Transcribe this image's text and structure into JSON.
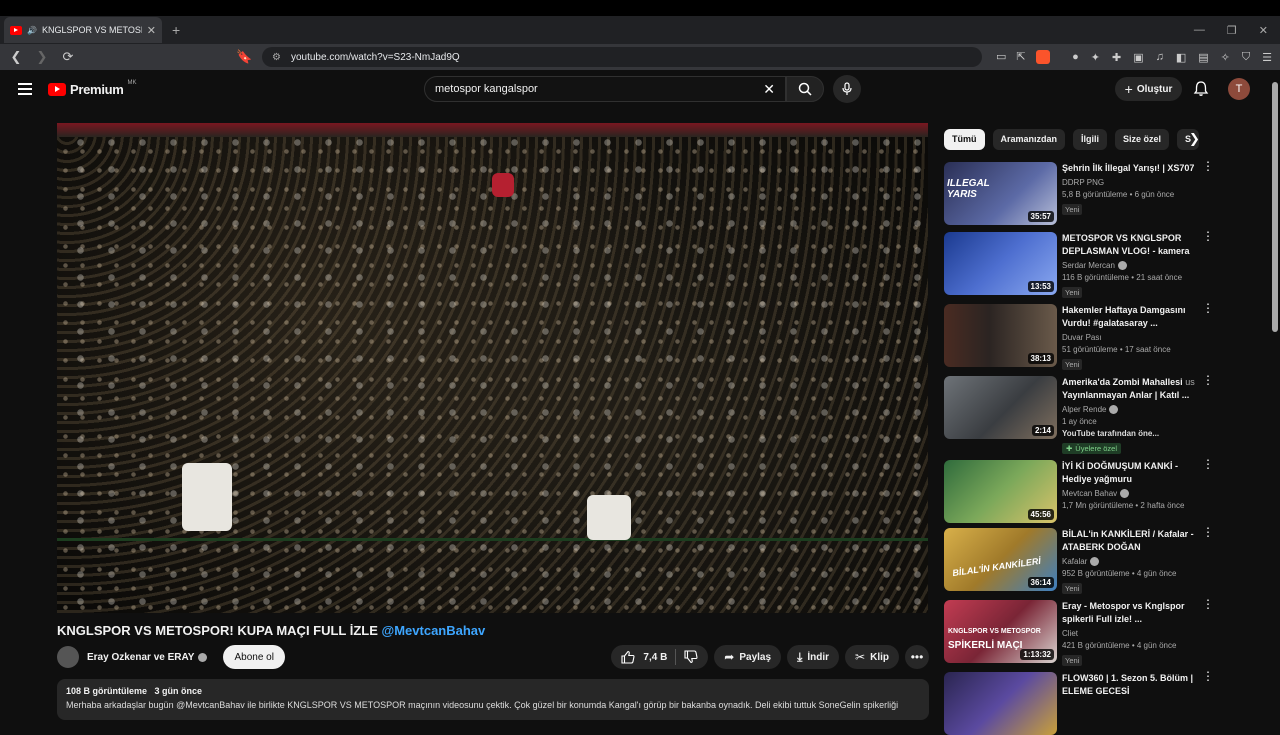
{
  "browser": {
    "tab_title": "KNGLSPOR VS METOSPOR! K",
    "url": "youtube.com/watch?v=S23-NmJad9Q"
  },
  "header": {
    "logo_text": "Premium",
    "logo_country": "MK",
    "search_query": "metospor kangalspor",
    "create_label": "Oluştur",
    "avatar_letter": "T"
  },
  "video": {
    "title": "KNGLSPOR VS METOSPOR! KUPA MAÇI FULL İZLE",
    "mention": "@MevtcanBahav",
    "channel": "Eray Ozkenar ve ERAY",
    "subscribe_label": "Abone ol",
    "likes": "7,4 B",
    "share_label": "Paylaş",
    "download_label": "İndir",
    "clip_label": "Klip",
    "views": "108 B görüntüleme",
    "age": "3 gün önce",
    "description": "Merhaba arkadaşlar bugün @MevtcanBahav ile birlikte KNGLSPOR VS METOSPOR maçının videosunu çektik. Çok güzel bir konumda Kangal'ı görüp bir bakanba oynadık. Deli ekibi tuttuk SoneGelin spikerliği"
  },
  "chips": [
    "Tümü",
    "Aramanızdan",
    "İlgili",
    "Size özel",
    "S"
  ],
  "recommendations": [
    {
      "title": "Şehrin İlk İllegal Yarışı! | XS707",
      "channel": "DDRP PNG",
      "verified": false,
      "stats": "5,8 B görüntüleme • 6 gün önce",
      "badge": "Yeni",
      "duration": "35:57",
      "color": "#3a3f6b"
    },
    {
      "title": "METOSPOR VS KNGLSPOR DEPLASMAN VLOG! - kamera ...",
      "channel": "Serdar Mercan",
      "verified": true,
      "stats": "116 B görüntüleme • 21 saat önce",
      "badge": "Yeni",
      "duration": "13:53",
      "color": "#2c4fa8"
    },
    {
      "title": "Hakemler Haftaya Damgasını Vurdu! #galatasaray ...",
      "channel": "Duvar Pası",
      "verified": false,
      "stats": "51 görüntüleme • 17 saat önce",
      "badge": "Yeni",
      "duration": "38:13",
      "color": "#3b2b26"
    },
    {
      "title": "Amerika'da Zombi Mahallesi",
      "title_suffix": "us",
      "title2": "Yayınlanmayan Anlar | Katıl ...",
      "channel": "Alper Rende",
      "verified": true,
      "stats": "1 ay önce",
      "badge2": "YouTube tarafından öne...",
      "members": "Üyelere özel",
      "duration": "2:14",
      "color": "#4a4e53"
    },
    {
      "title": "İYİ Kİ DOĞMUŞUM KANKİ - Hediye yağmuru",
      "channel": "Mevtcan Bahav",
      "verified": true,
      "stats": "1,7 Mn görüntüleme • 2 hafta önce",
      "duration": "45:56",
      "color": "#3f7a4a"
    },
    {
      "title": "BİLAL'in KANKİLERİ / Kafalar - ATABERK DOĞAN",
      "channel": "Kafalar",
      "verified": true,
      "stats": "952 B görüntüleme • 4 gün önce",
      "badge": "Yeni",
      "duration": "36:14",
      "color": "#c9a13a"
    },
    {
      "title": "Eray - Metospor vs Knglspor spikerli Full izle! ...",
      "channel": "Cliet",
      "verified": false,
      "stats": "421 B görüntüleme • 4 gün önce",
      "badge": "Yeni",
      "duration": "1:13:32",
      "color": "#a03a4f"
    },
    {
      "title": "FLOW360 | 1. Sezon 5. Bölüm | ELEME GECESİ",
      "channel": "",
      "verified": false,
      "stats": "",
      "duration": "",
      "color": "#3b3566"
    }
  ]
}
